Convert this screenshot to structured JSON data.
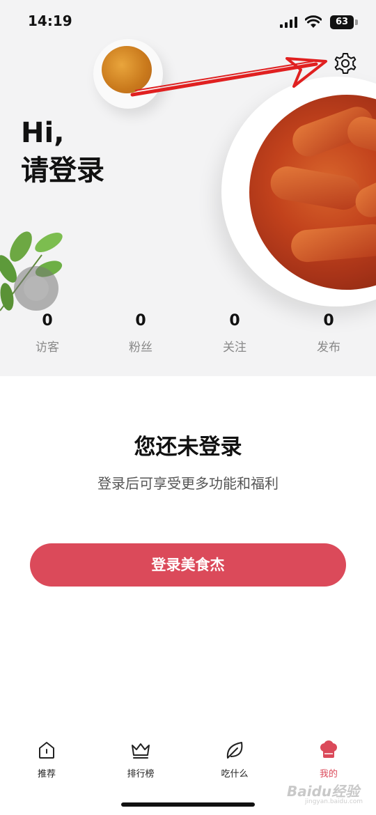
{
  "status_bar": {
    "time": "14:19",
    "battery": "63"
  },
  "header": {
    "greeting_line1": "Hi,",
    "greeting_line2": "请登录",
    "settings_icon": "gear-icon"
  },
  "stats": [
    {
      "value": "0",
      "label": "访客"
    },
    {
      "value": "0",
      "label": "粉丝"
    },
    {
      "value": "0",
      "label": "关注"
    },
    {
      "value": "0",
      "label": "发布"
    }
  ],
  "main": {
    "title": "您还未登录",
    "subtitle": "登录后可享受更多功能和福利",
    "login_button": "登录美食杰"
  },
  "tabbar": {
    "items": [
      {
        "label": "推荐",
        "icon": "home-icon"
      },
      {
        "label": "排行榜",
        "icon": "crown-icon"
      },
      {
        "label": "吃什么",
        "icon": "leaf-icon"
      },
      {
        "label": "我的",
        "icon": "chef-hat-icon"
      }
    ],
    "active_index": 3
  },
  "watermark": {
    "text": "Baidu经验",
    "sub": "jingyan.baidu.com"
  },
  "colors": {
    "accent": "#db4a5a",
    "annotation_arrow": "#e02020"
  }
}
